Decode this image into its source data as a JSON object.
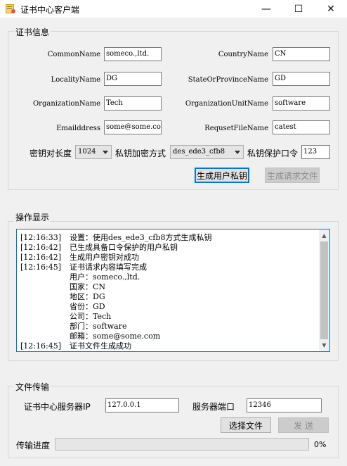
{
  "window": {
    "title": "证书中心客户端",
    "minimize": "—",
    "maximize": "☐",
    "close": "✕"
  },
  "cert_group": {
    "legend": "证书信息",
    "fields": {
      "common_name": {
        "label": "CommonName",
        "value": "someco.,ltd."
      },
      "country_name": {
        "label": "CountryName",
        "value": "CN"
      },
      "locality_name": {
        "label": "LocalityName",
        "value": "DG"
      },
      "state_name": {
        "label": "StateOrProvinceName",
        "value": "GD"
      },
      "organization_name": {
        "label": "OrganizationName",
        "value": "Tech"
      },
      "org_unit_name": {
        "label": "OrganizationUnitName",
        "value": "software"
      },
      "email_address": {
        "label": "Emailddress",
        "value": "some@some.com"
      },
      "request_file_name": {
        "label": "RequsetFileName",
        "value": "catest"
      }
    },
    "key_length": {
      "label": "密钥对长度",
      "value": "1024"
    },
    "encrypt_method": {
      "label": "私钥加密方式",
      "value": "des_ede3_cfb8"
    },
    "key_password": {
      "label": "私钥保护口令",
      "value": "123"
    },
    "generate_key_button": "生成用户私钥",
    "generate_request_button": "生成请求文件"
  },
  "log_group": {
    "legend": "操作显示",
    "lines": [
      {
        "time": "[12:16:33]",
        "text": "设置：使用des_ede3_cfb8方式生成私钥"
      },
      {
        "time": "[12:16:42]",
        "text": "已生成具备口令保护的用户私钥"
      },
      {
        "time": "[12:16:42]",
        "text": "生成用户密钥对成功"
      },
      {
        "time": "[12:16:45]",
        "text": "证书请求内容填写完成"
      },
      {
        "time": "",
        "text": "用户：someco.,ltd."
      },
      {
        "time": "",
        "text": "国家：CN"
      },
      {
        "time": "",
        "text": "地区：DG"
      },
      {
        "time": "",
        "text": "省份：GD"
      },
      {
        "time": "",
        "text": "公司：Tech"
      },
      {
        "time": "",
        "text": "部门：software"
      },
      {
        "time": "",
        "text": "邮箱：some@some.com"
      },
      {
        "time": "[12:16:45]",
        "text": "证书文件生成成功"
      }
    ]
  },
  "transfer_group": {
    "legend": "文件传输",
    "server_ip": {
      "label": "证书中心服务器IP",
      "value": "127.0.0.1"
    },
    "server_port": {
      "label": "服务器端口",
      "value": "12346"
    },
    "choose_file_button": "选择文件",
    "send_button": "发 送",
    "progress": {
      "label": "传输进度",
      "percent_text": "0%",
      "value": 0
    }
  },
  "colors": {
    "accent": "#0078d7",
    "progress_fill": "#06b025"
  }
}
